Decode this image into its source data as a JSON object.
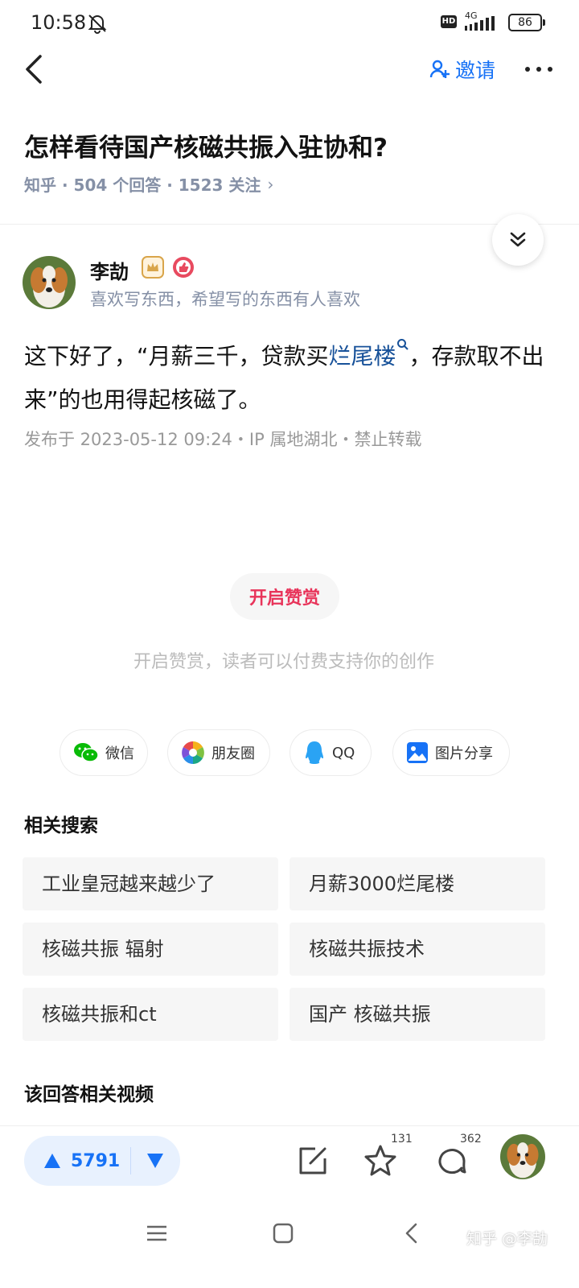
{
  "status_bar": {
    "time": "10:58",
    "network": "4G",
    "hd": "HD",
    "battery": "86"
  },
  "nav": {
    "invite_label": "邀请"
  },
  "question": {
    "title": "怎样看待国产核磁共振入驻协和?",
    "meta": "知乎 · 504 个回答 · 1523 关注",
    "meta_chevron": "›"
  },
  "author": {
    "name": "李劼",
    "bio": "喜欢写东西，希望写的东西有人喜欢"
  },
  "answer": {
    "text_part1": "这下好了，“月薪三千，贷款买",
    "link": "烂尾楼",
    "text_part2": "，存款取不出来”的也用得起核磁了。",
    "post_meta": "发布于 2023-05-12 09:24・IP 属地湖北・禁止转载"
  },
  "reward": {
    "button": "开启赞赏",
    "desc": "开启赞赏，读者可以付费支持你的创作"
  },
  "share": [
    {
      "label": "微信",
      "icon": "wechat-icon"
    },
    {
      "label": "朋友圈",
      "icon": "moments-icon"
    },
    {
      "label": "QQ",
      "icon": "qq-icon"
    },
    {
      "label": "图片分享",
      "icon": "image-share-icon"
    }
  ],
  "related": {
    "title": "相关搜索",
    "items": [
      "工业皇冠越来越少了",
      "月薪3000烂尾楼",
      "核磁共振 辐射",
      "核磁共振技术",
      "核磁共振和ct",
      "国产 核磁共振"
    ]
  },
  "videos": {
    "title": "该回答相关视频"
  },
  "bottom_bar": {
    "upvotes": "5791",
    "favorites": "131",
    "comments": "362"
  },
  "watermark": "知乎 @李劼",
  "colors": {
    "accent": "#1772f6",
    "reward": "#e8345a",
    "meta": "#8590a6"
  }
}
